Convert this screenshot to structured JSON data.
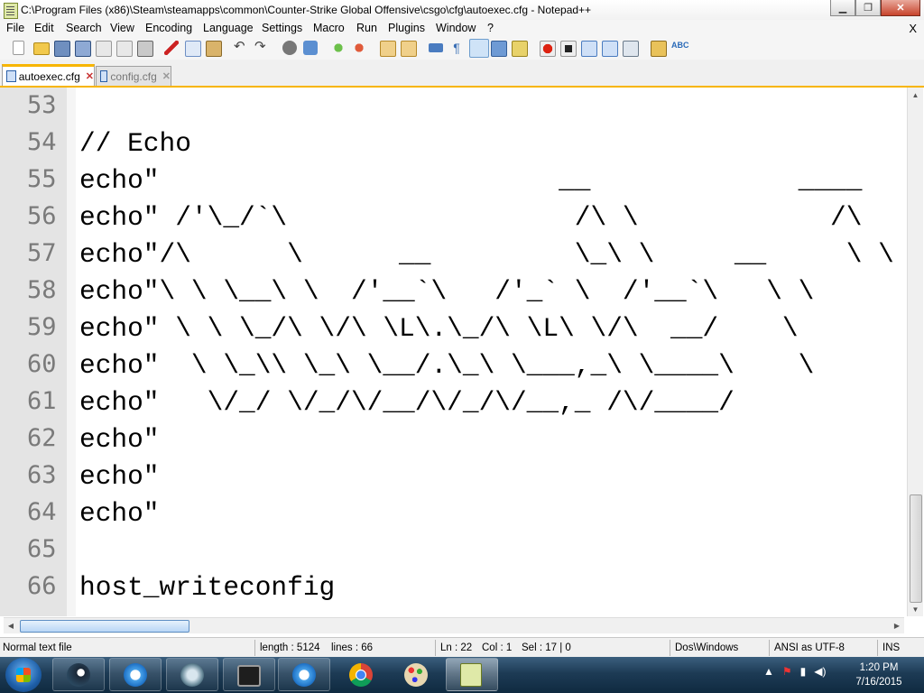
{
  "window": {
    "title": "C:\\Program Files (x86)\\Steam\\steamapps\\common\\Counter-Strike Global Offensive\\csgo\\cfg\\autoexec.cfg - Notepad++",
    "minimize": "▁",
    "maximize": "❐",
    "close": "✕"
  },
  "menu": {
    "items": [
      "File",
      "Edit",
      "Search",
      "View",
      "Encoding",
      "Language",
      "Settings",
      "Macro",
      "Run",
      "Plugins",
      "Window",
      "?"
    ],
    "close_doc": "X"
  },
  "toolbar": {
    "icons": [
      "new-file-icon",
      "open-file-icon",
      "save-icon",
      "save-all-icon",
      "close-icon",
      "close-all-icon",
      "print-icon",
      "cut-icon",
      "copy-icon",
      "paste-icon",
      "undo-icon",
      "redo-icon",
      "find-icon",
      "replace-icon",
      "zoom-in-icon",
      "zoom-out-icon",
      "sync-vertical-icon",
      "sync-horizontal-icon",
      "word-wrap-icon",
      "show-all-chars-icon",
      "indent-guide-icon",
      "language-icon",
      "doc-map-icon",
      "record-macro-icon",
      "stop-record-icon",
      "play-macro-icon",
      "run-macro-multiple-icon",
      "save-macro-icon",
      "launch-browser-icon",
      "spell-check-icon"
    ]
  },
  "tabs": [
    {
      "label": "autoexec.cfg",
      "active": true
    },
    {
      "label": "config.cfg",
      "active": false
    }
  ],
  "editor": {
    "lines": [
      {
        "num": "53",
        "text": ""
      },
      {
        "num": "54",
        "text": "// Echo"
      },
      {
        "num": "55",
        "text": "echo\"                         __             ____"
      },
      {
        "num": "56",
        "text": "echo\" /'\\_/`\\                  /\\ \\            /\\"
      },
      {
        "num": "57",
        "text": "echo\"/\\      \\      __         \\_\\ \\     __     \\ \\"
      },
      {
        "num": "58",
        "text": "echo\"\\ \\ \\__\\ \\  /'__`\\   /'_` \\  /'__`\\   \\ \\"
      },
      {
        "num": "59",
        "text": "echo\" \\ \\ \\_/\\ \\/\\ \\L\\.\\_/\\ \\L\\ \\/\\  __/    \\"
      },
      {
        "num": "60",
        "text": "echo\"  \\ \\_\\\\ \\_\\ \\__/.\\_\\ \\___,_\\ \\____\\    \\"
      },
      {
        "num": "61",
        "text": "echo\"   \\/_/ \\/_/\\/__/\\/_/\\/__,_ /\\/____/"
      },
      {
        "num": "62",
        "text": "echo\""
      },
      {
        "num": "63",
        "text": "echo\""
      },
      {
        "num": "64",
        "text": "echo\""
      },
      {
        "num": "65",
        "text": ""
      },
      {
        "num": "66",
        "text": "host_writeconfig"
      }
    ]
  },
  "status": {
    "type": "Normal text file",
    "length": "length : 5124",
    "lines": "lines : 66",
    "ln": "Ln : 22",
    "col": "Col : 1",
    "sel": "Sel : 17 | 0",
    "eol": "Dos\\Windows",
    "encoding": "ANSI as UTF-8",
    "mode": "INS"
  },
  "taskbar": {
    "apps": [
      "steam-icon",
      "itunes-icon",
      "hamachi-icon",
      "system-monitor-icon",
      "itunes-icon",
      "chrome-icon",
      "paint-icon",
      "notepad-plus-plus-icon"
    ],
    "clock_time": "1:20 PM",
    "clock_date": "7/16/2015"
  },
  "colors": {
    "tab_accent": "#f7b500",
    "gutter_bg": "#e4e4e4",
    "taskbar_bg": "#1d3b55"
  }
}
